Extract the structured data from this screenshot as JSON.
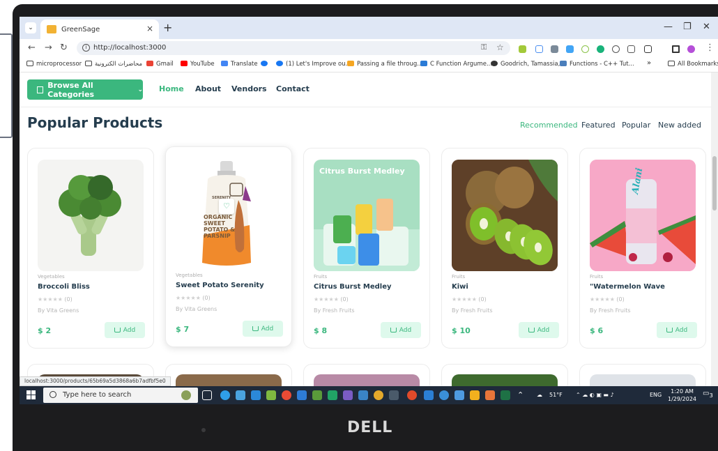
{
  "browser": {
    "tab_title": "GreenSage",
    "tab_close": "×",
    "new_tab": "+",
    "url": "http://localhost:3000",
    "bookmarks": [
      "microprocessor",
      "محاضرات الكترونية",
      "Gmail",
      "YouTube",
      "Translate",
      "(1) Let's Improve ou...",
      "Passing a file throug...",
      "C Function Argume...",
      "Goodrich, Tamassia,...",
      "Functions - C++ Tut...",
      "»",
      "All Bookmarks"
    ],
    "status_url": "localhost:3000/products/65b69a5d3868a6b7adfbf5e0"
  },
  "nav": {
    "browse_label": "Browse All Categories",
    "links": [
      "Home",
      "About",
      "Vendors",
      "Contact"
    ],
    "active_link": "Home"
  },
  "section": {
    "title": "Popular Products",
    "filters": [
      "Recommended",
      "Featured",
      "Popular",
      "New added"
    ],
    "active_filter": "Recommended"
  },
  "products": [
    {
      "category": "Vegetables",
      "name": "Broccoli Bliss",
      "rating": "★★★★★",
      "reviews": "(0)",
      "vendor": "By Vita Greens",
      "price": "$ 2",
      "add_label": "Add"
    },
    {
      "category": "Vegetables",
      "name": "Sweet Potato Serenity",
      "rating": "★★★★★",
      "reviews": "(0)",
      "vendor": "By Vita Greens",
      "price": "$ 7",
      "add_label": "Add",
      "package_text": "ORGANIC SWEET POTATO & PARSNIP",
      "brand_text": "SERENITY"
    },
    {
      "category": "Fruits",
      "name": "Citrus Burst Medley",
      "rating": "★★★★★",
      "reviews": "(0)",
      "vendor": "By Fresh Fruits",
      "price": "$ 8",
      "add_label": "Add",
      "image_text": "Citrus Burst Medley"
    },
    {
      "category": "Fruits",
      "name": "Kiwi",
      "rating": "★★★★★",
      "reviews": "(0)",
      "vendor": "By Fresh Fruits",
      "price": "$ 10",
      "add_label": "Add"
    },
    {
      "category": "Fruits",
      "name": "\"Watermelon Wave",
      "rating": "★★★★★",
      "reviews": "(0)",
      "vendor": "By Fresh Fruits",
      "price": "$ 6",
      "add_label": "Add",
      "can_text": "Alani"
    }
  ],
  "taskbar": {
    "search_placeholder": "Type here to search",
    "weather": "51°F",
    "language": "ENG",
    "time": "1:20 AM",
    "date": "1/29/2024",
    "notifications": "3"
  },
  "device": {
    "brand": "DELL"
  },
  "colors": {
    "accent": "#3bb77e",
    "heading": "#253d4e",
    "taskbar": "#1f2a3a"
  }
}
